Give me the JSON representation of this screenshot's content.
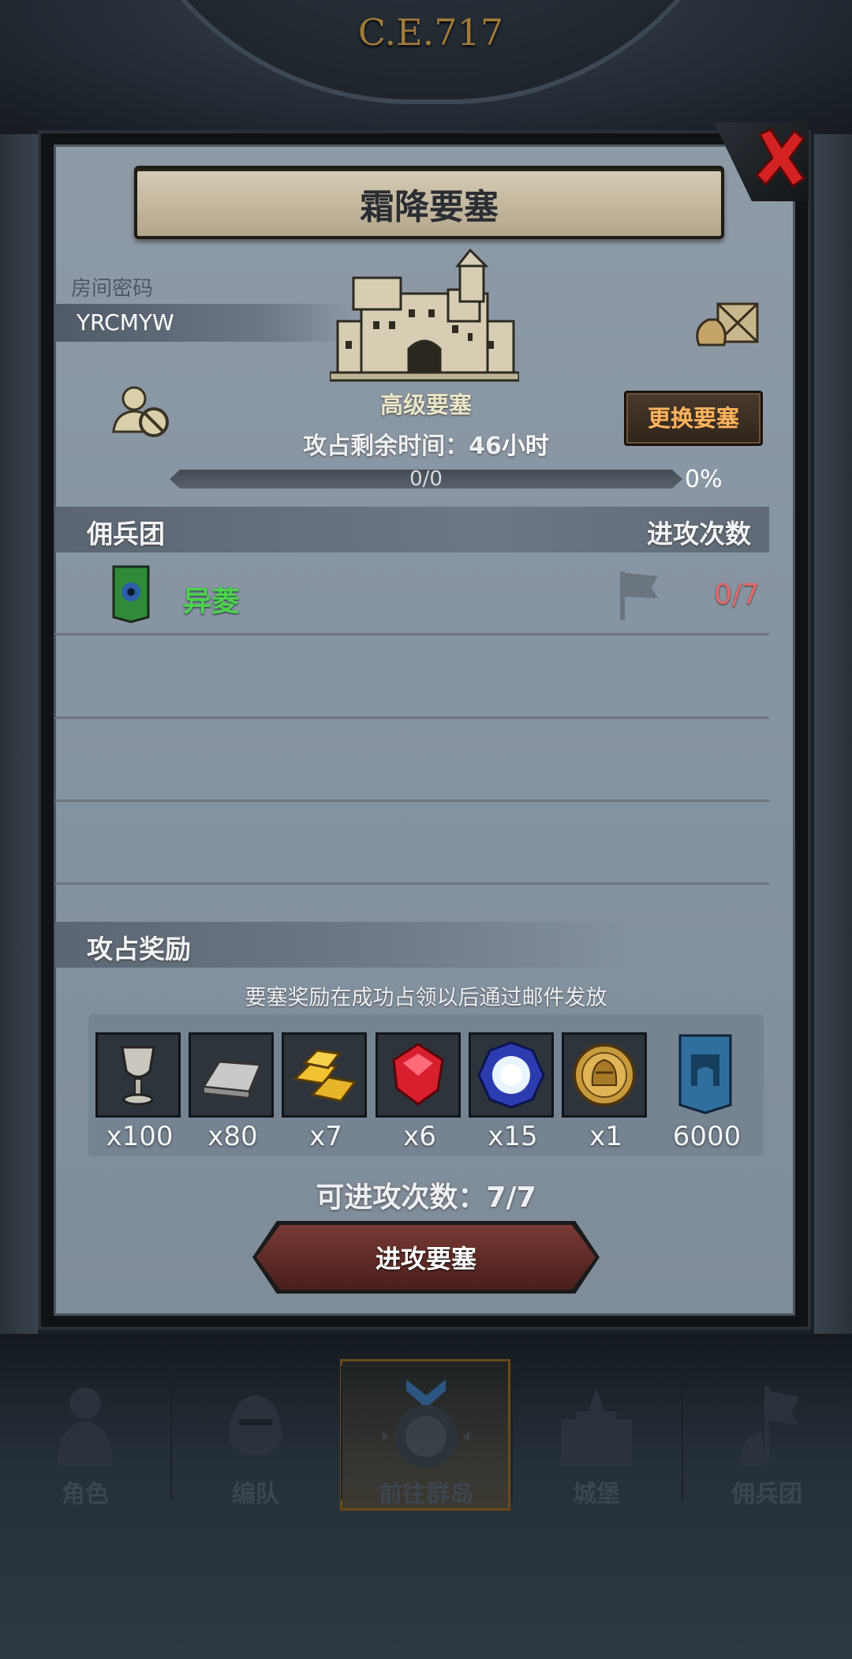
{
  "header": {
    "era": "C.E.717"
  },
  "modal": {
    "title": "霜降要塞",
    "room": {
      "label": "房间密码",
      "code": "YRCMYW"
    },
    "fortress_level": "高级要塞",
    "change_button": "更换要塞",
    "time_label": "攻占剩余时间：46",
    "time_unit": "小时",
    "progress": {
      "text": "0/0",
      "percent_text": "0%",
      "fraction": 0
    },
    "mercenaries": {
      "header_left": "佣兵团",
      "header_right": "进攻次数",
      "rows": [
        {
          "name": "异菱",
          "attacks": "0/7"
        }
      ]
    },
    "rewards": {
      "title": "攻占奖励",
      "note": "要塞奖励在成功占领以后通过邮件发放",
      "items": [
        {
          "icon": "chalice-icon",
          "qty": "x100"
        },
        {
          "icon": "iron-ingot-icon",
          "qty": "x80"
        },
        {
          "icon": "gold-bars-icon",
          "qty": "x7"
        },
        {
          "icon": "ruby-icon",
          "qty": "x6"
        },
        {
          "icon": "blue-crystal-icon",
          "qty": "x15"
        },
        {
          "icon": "knight-coin-icon",
          "qty": "x1"
        },
        {
          "icon": "fortress-banner-icon",
          "qty": "6000"
        }
      ]
    },
    "attacks_available": "可进攻次数：7/7",
    "attack_button": "进攻要塞"
  },
  "nav": {
    "items": [
      {
        "label": "角色",
        "icon": "knight-icon"
      },
      {
        "label": "编队",
        "icon": "helmet-icon"
      },
      {
        "label": "前往群岛",
        "icon": "compass-icon",
        "active": true
      },
      {
        "label": "城堡",
        "icon": "castle-icon"
      },
      {
        "label": "佣兵团",
        "icon": "mercenary-icon"
      }
    ]
  },
  "colors": {
    "merc_name": "#4bd44b",
    "attack_count": "#e46a6a",
    "change_button_text": "#ffb35c",
    "attack_button": "#6a302b"
  }
}
